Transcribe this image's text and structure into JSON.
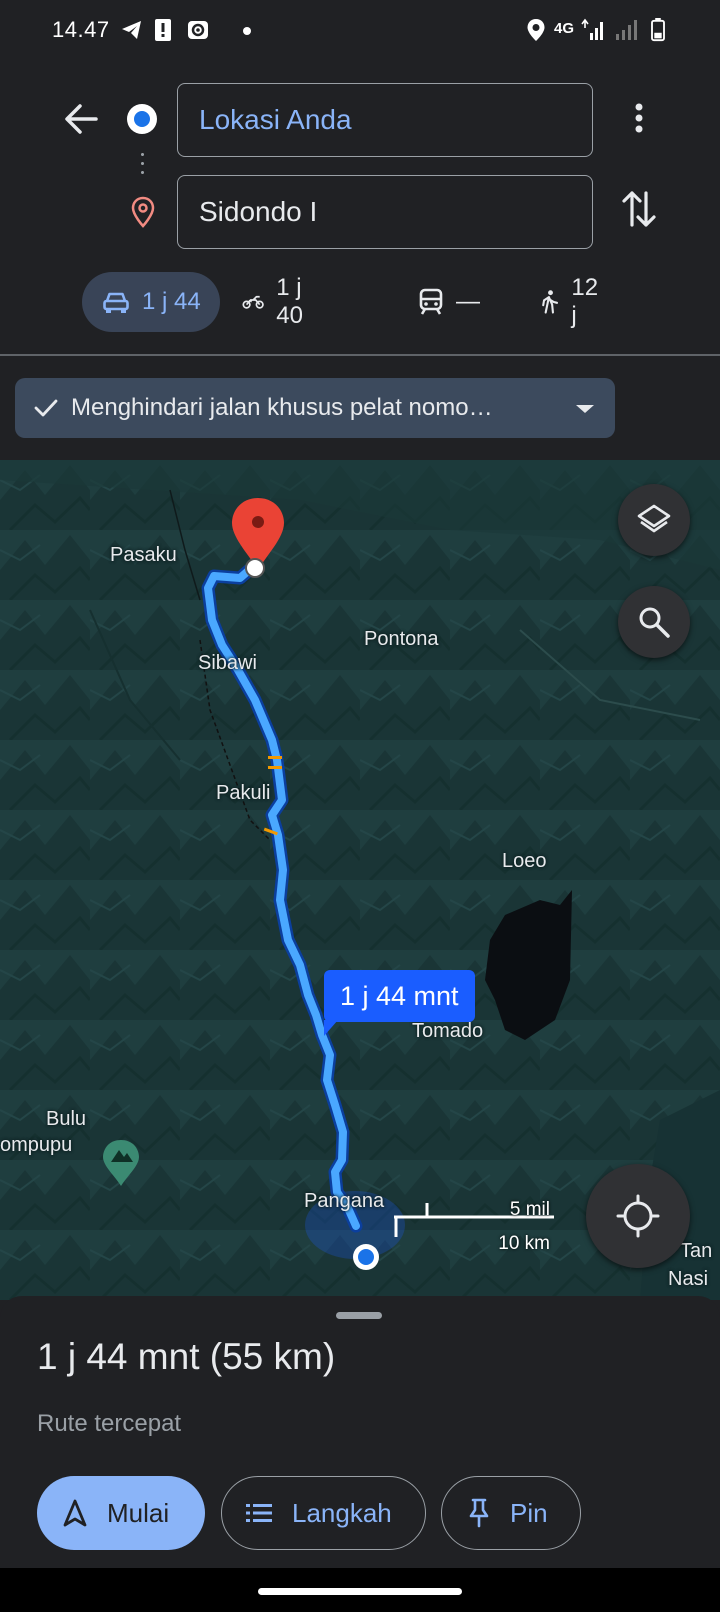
{
  "status_bar": {
    "time": "14.47",
    "network": "4G",
    "icons": [
      "telegram-icon",
      "alert-icon",
      "cast-icon",
      "location-icon",
      "signal-icon",
      "battery-icon"
    ]
  },
  "directions": {
    "origin": "Lokasi Anda",
    "destination": "Sidondo I",
    "modes": [
      {
        "icon": "car-icon",
        "label": "1 j 44",
        "active": true
      },
      {
        "icon": "motorcycle-icon",
        "label": "1 j 40",
        "active": false
      },
      {
        "icon": "transit-icon",
        "label": "—",
        "active": false
      },
      {
        "icon": "walk-icon",
        "label": "12 j",
        "active": false
      }
    ],
    "filter_chip": "Menghindari jalan khusus pelat nomo…"
  },
  "map": {
    "places": [
      "Pasaku",
      "Pontona",
      "Sibawi",
      "Pakuli",
      "Loeo",
      "Tomado",
      "Bulu",
      "ompupu",
      "Pangana",
      "Tan",
      "Nasi"
    ],
    "route_label": "1 j 44 mnt",
    "scale_top": "5 mil",
    "scale_bottom": "10 km",
    "route_color": "#1a5dff",
    "route_line_color": "#4aa8ff"
  },
  "sheet": {
    "summary": "1 j 44 mnt (55 km)",
    "subtitle": "Rute tercepat",
    "start_label": "Mulai",
    "steps_label": "Langkah",
    "pin_label": "Pin"
  },
  "colors": {
    "accent": "#8ab4f8",
    "background": "#202124",
    "map_bg": "#1d3a3b"
  }
}
